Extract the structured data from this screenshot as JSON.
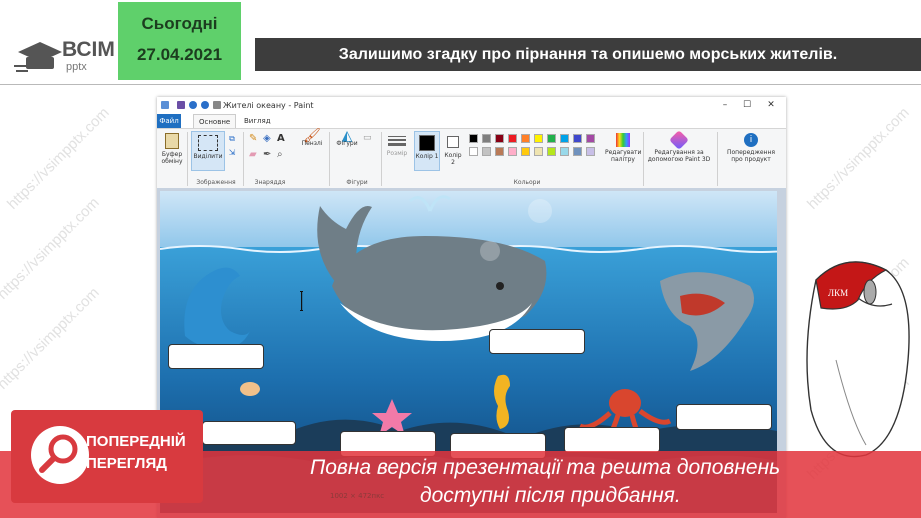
{
  "logo": {
    "brand": "ВСІМ",
    "sub": "pptx"
  },
  "date_badge": {
    "label": "Сьогодні",
    "date": "27.04.2021"
  },
  "header": {
    "title": "Залишимо згадку про пірнання та опишемо морських жителів."
  },
  "paint": {
    "window_title": "Жителі океану - Paint",
    "tabs": [
      "Файл",
      "Основне",
      "Вигляд"
    ],
    "ribbon": {
      "clipboard": "Буфер обміну",
      "select": "Виділити",
      "group_image": "Зображення",
      "group_tools": "Знаряддя",
      "brushes": "Пензлі",
      "shapes": "Фігури",
      "group_shapes": "Фігури",
      "size": "Розмір",
      "color1": "Колір 1",
      "color2": "Колір 2",
      "group_colors": "Кольори",
      "edit_palette": "Редагувати палітру",
      "paint3d": "Редагування за допомогою Paint 3D",
      "warning": "Попередження про продукт"
    },
    "palette": [
      "#000000",
      "#7f7f7f",
      "#880015",
      "#ed1c24",
      "#ff7f27",
      "#fff200",
      "#22b14c",
      "#00a2e8",
      "#3f48cc",
      "#a349a4",
      "#ffffff",
      "#c3c3c3",
      "#b97a57",
      "#ffaec9",
      "#ffc90e",
      "#efe4b0",
      "#b5e61d",
      "#99d9ea",
      "#7092be",
      "#c8bfe7"
    ],
    "status_size": "1002 × 472пкс"
  },
  "mouse_label": "ЛКМ",
  "banner": {
    "badge_title_1": "ПОПЕРЕДНІЙ",
    "badge_title_2": "ПЕРЕГЛЯД",
    "line1": "Повна версія презентації та решта доповнень",
    "line2": "доступні після придбання."
  },
  "watermark": "https://vsimpptx.com",
  "colors": {
    "accent_green": "#5fd06b",
    "header_bg": "#3d3d3d",
    "banner_red": "#e2343c",
    "paint_blue": "#1f6fc1"
  }
}
